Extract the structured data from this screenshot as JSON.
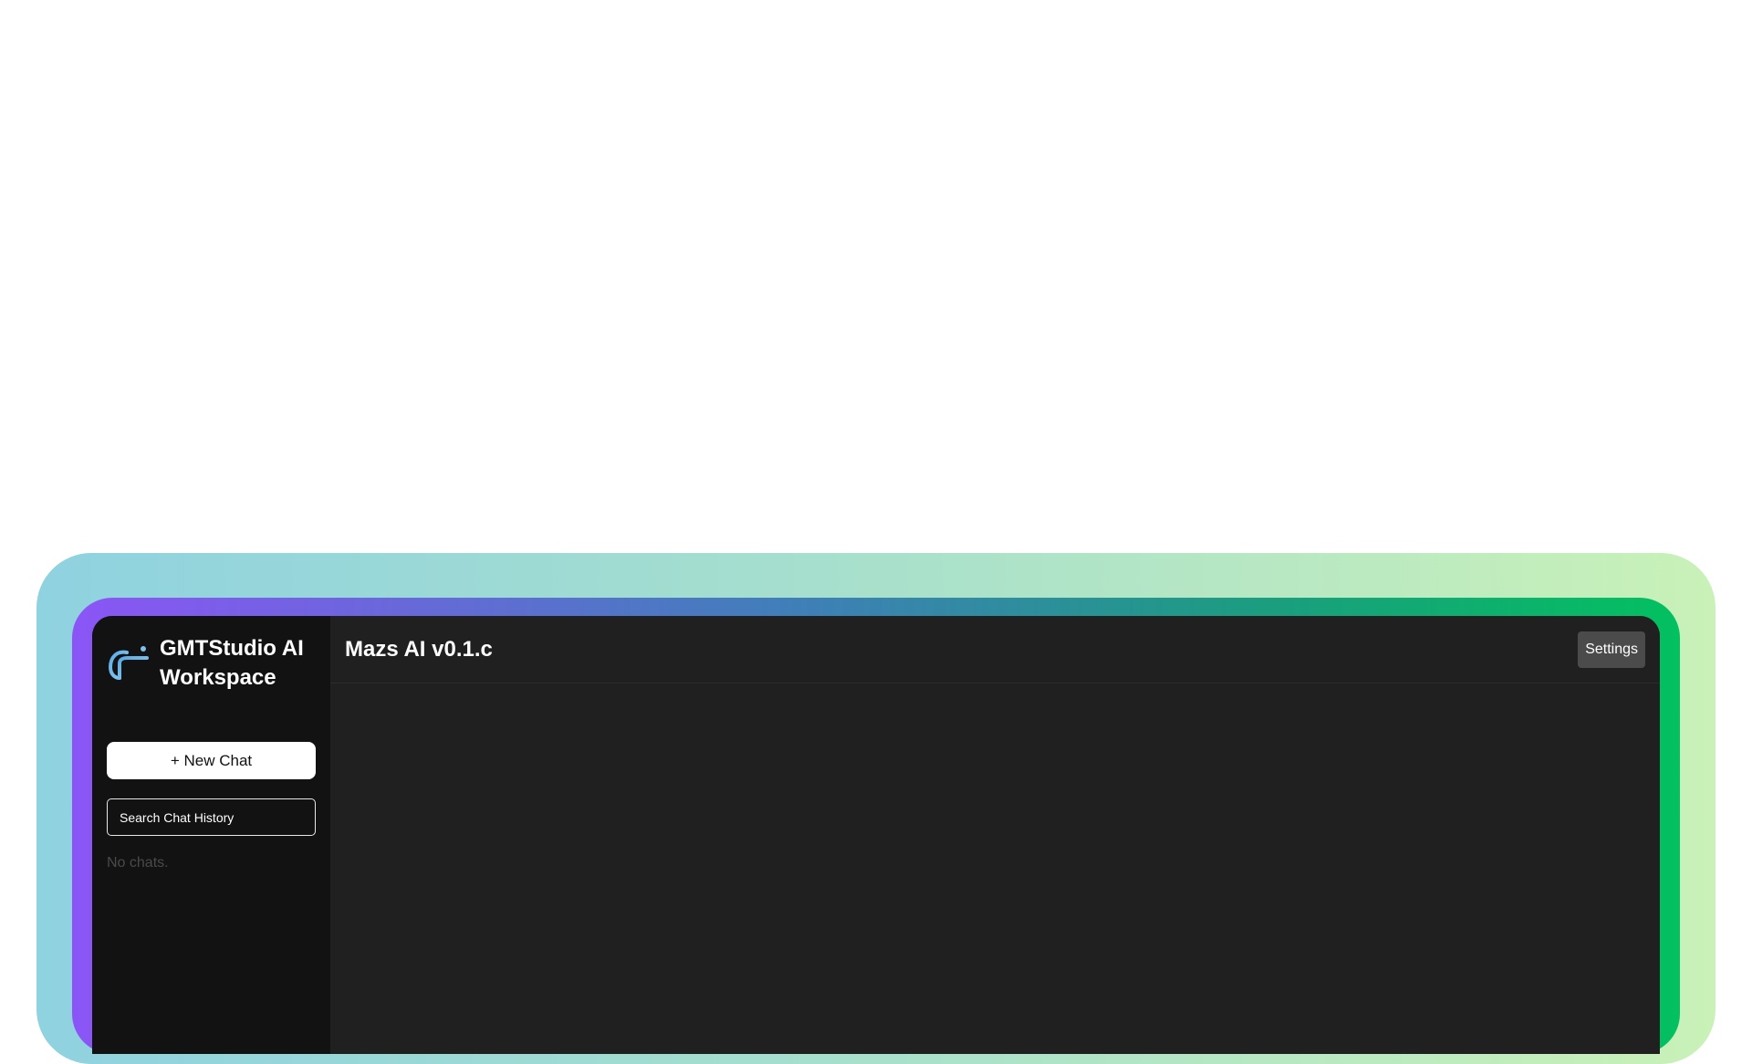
{
  "sidebar": {
    "brand_title": "GMTStudio AI Workspace",
    "logo_icon": "gmt-logo-icon",
    "new_chat_label": "+ New Chat",
    "search_placeholder": "Search Chat History",
    "empty_state": "No chats."
  },
  "header": {
    "title": "Mazs AI v0.1.c",
    "settings_label": "Settings"
  },
  "colors": {
    "accent_gradient_start": "#8b55f6",
    "accent_gradient_end": "#03c060",
    "sidebar_bg": "#121212",
    "main_bg": "#202020"
  }
}
